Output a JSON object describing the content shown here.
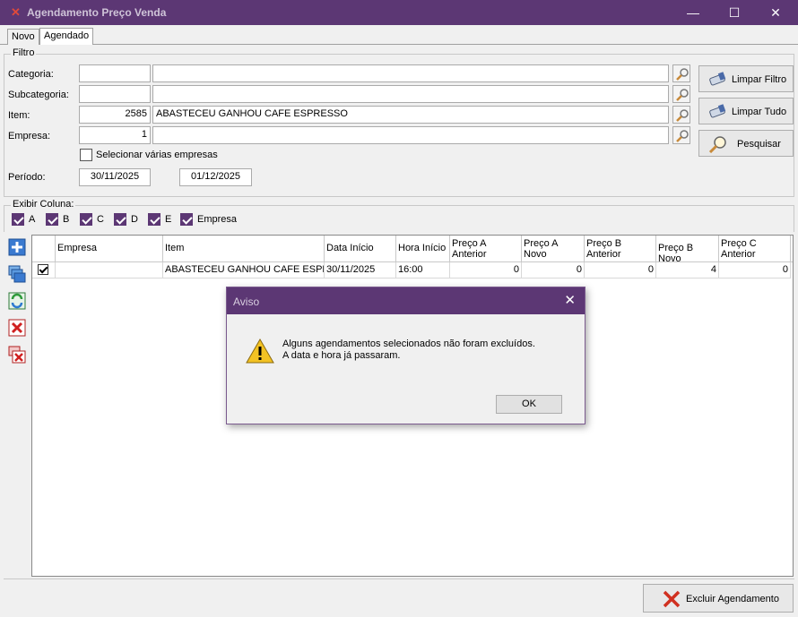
{
  "window": {
    "title": "Agendamento Preço Venda",
    "minimize": "—",
    "maximize": "☐",
    "close": "✕"
  },
  "tabs": [
    {
      "label": "Novo"
    },
    {
      "label": "Agendado"
    }
  ],
  "filtro": {
    "group_label": "Filtro",
    "categoria": {
      "label": "Categoria:",
      "code": "",
      "desc": ""
    },
    "subcategoria": {
      "label": "Subcategoria:",
      "code": "",
      "desc": ""
    },
    "item": {
      "label": "Item:",
      "code": "2585",
      "desc": "ABASTECEU GANHOU CAFE ESPRESSO"
    },
    "empresa": {
      "label": "Empresa:",
      "code": "1",
      "desc": ""
    },
    "selecionar_varias": "Selecionar várias empresas",
    "periodo": {
      "label": "Período:",
      "inicio": "30/11/2025",
      "fim": "01/12/2025"
    }
  },
  "buttons": {
    "limpar_filtro": "Limpar Filtro",
    "limpar_tudo": "Limpar Tudo",
    "pesquisar": "Pesquisar",
    "excluir": "Excluir Agendamento"
  },
  "exibir_coluna": {
    "label": "Exibir Coluna:",
    "options": [
      {
        "label": "A",
        "checked": true
      },
      {
        "label": "B",
        "checked": true
      },
      {
        "label": "C",
        "checked": true
      },
      {
        "label": "D",
        "checked": true
      },
      {
        "label": "E",
        "checked": true
      },
      {
        "label": "Empresa",
        "checked": true
      }
    ]
  },
  "grid": {
    "headers": [
      "Empresa",
      "Item",
      "Data Início",
      "Hora Início",
      "Preço A Anterior",
      "Preço A Novo",
      "Preço B Anterior",
      "Preço B Novo",
      "Preço C Anterior"
    ],
    "rows": [
      {
        "selected": true,
        "empresa": "",
        "item": "ABASTECEU GANHOU CAFE ESPRESSO",
        "data_inicio": "30/11/2025",
        "hora_inicio": "16:00",
        "preco_a_anterior": "0",
        "preco_a_novo": "0",
        "preco_b_anterior": "0",
        "preco_b_novo": "4",
        "preco_c_anterior": "0"
      }
    ]
  },
  "dialog": {
    "title": "Aviso",
    "close": "✕",
    "line1": "Alguns agendamentos selecionados não foram excluídos.",
    "line2": "A data e hora já passaram.",
    "ok": "OK"
  },
  "colors": {
    "titlebar": "#5c3774",
    "accent": "#5c3774"
  }
}
